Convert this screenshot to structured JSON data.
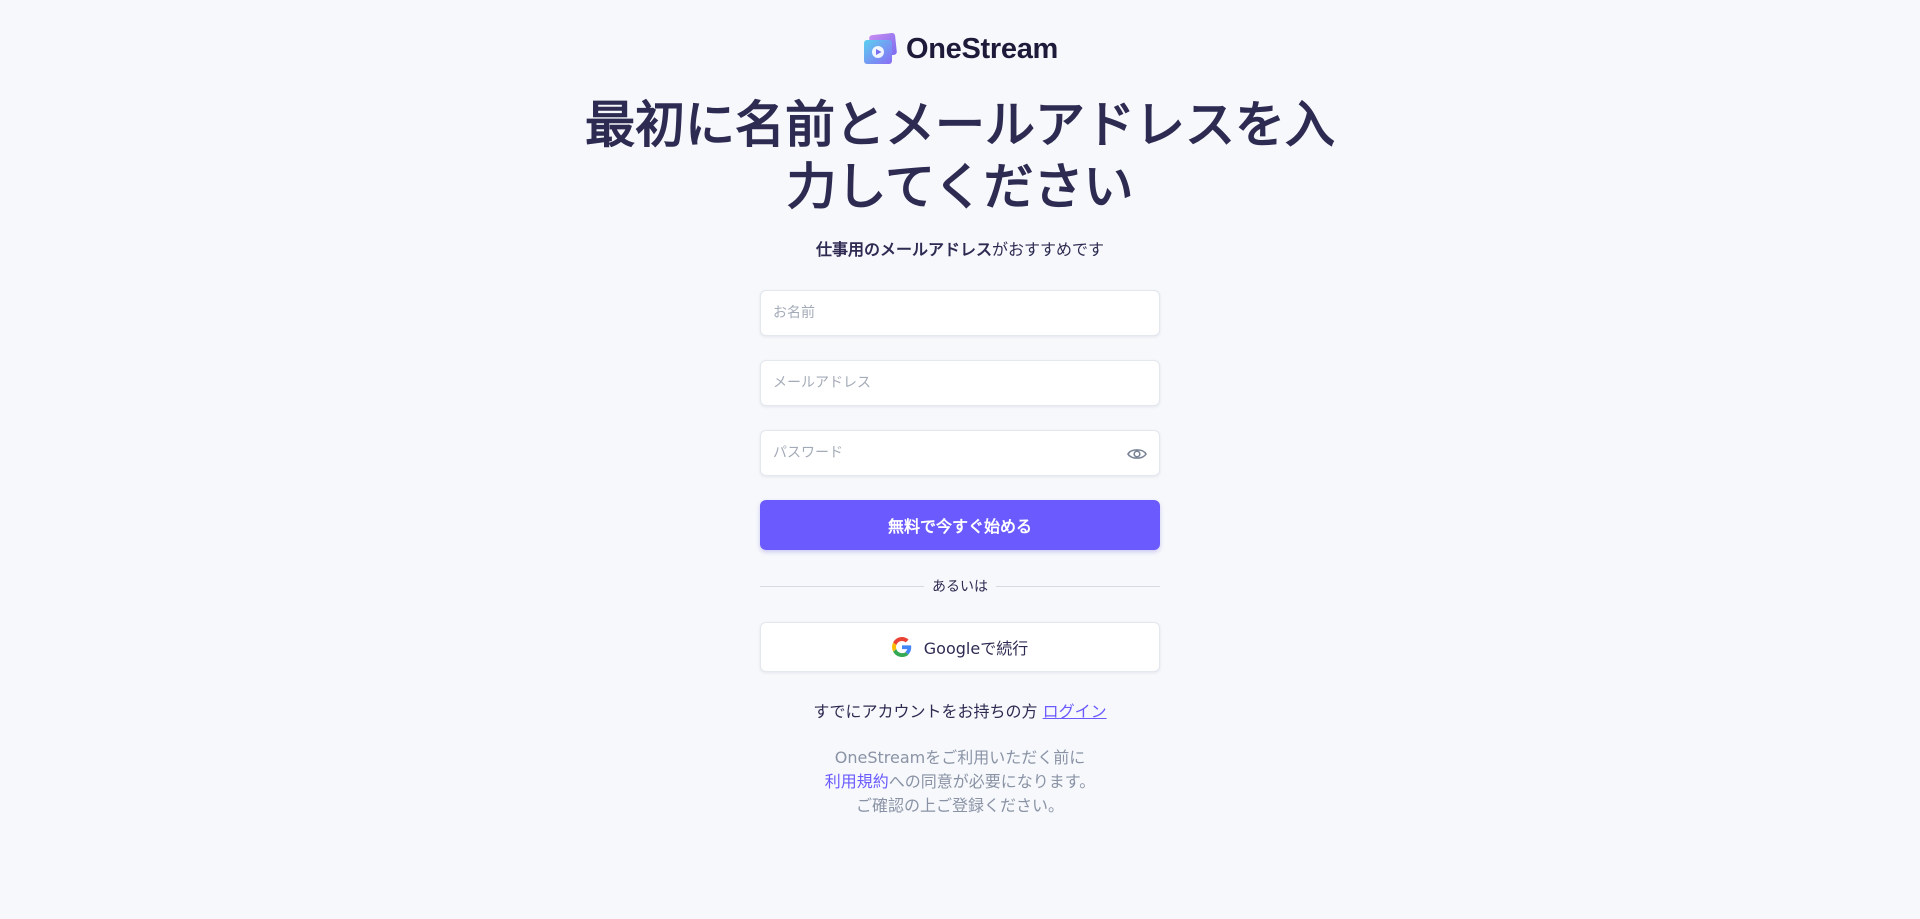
{
  "brand": {
    "name": "OneStream",
    "icon": "onestream-logo-icon"
  },
  "heading": {
    "line1": "最初に名前とメールアドレスを入",
    "line2": "力してください"
  },
  "subtitle": {
    "bold": "仕事用のメールアドレス",
    "rest": "がおすすめです"
  },
  "form": {
    "name_placeholder": "お名前",
    "email_placeholder": "メールアドレス",
    "password_placeholder": "パスワード",
    "password_toggle_icon": "eye-icon",
    "submit_label": "無料で今すぐ始める"
  },
  "divider": {
    "text": "あるいは"
  },
  "google": {
    "label": "Googleで続行",
    "icon": "google-icon"
  },
  "login": {
    "prompt": "すでにアカウントをお持ちの方",
    "link": "ログイン"
  },
  "terms": {
    "line1": "OneStreamをご利用いただく前に",
    "link": "利用規約",
    "line2_rest": "への同意が必要になります。",
    "line3": "ご確認の上ご登録ください。"
  },
  "colors": {
    "accent": "#6b5bfe",
    "heading": "#2d2b52",
    "muted": "#8a93a6",
    "background": "#f6f8fb"
  }
}
